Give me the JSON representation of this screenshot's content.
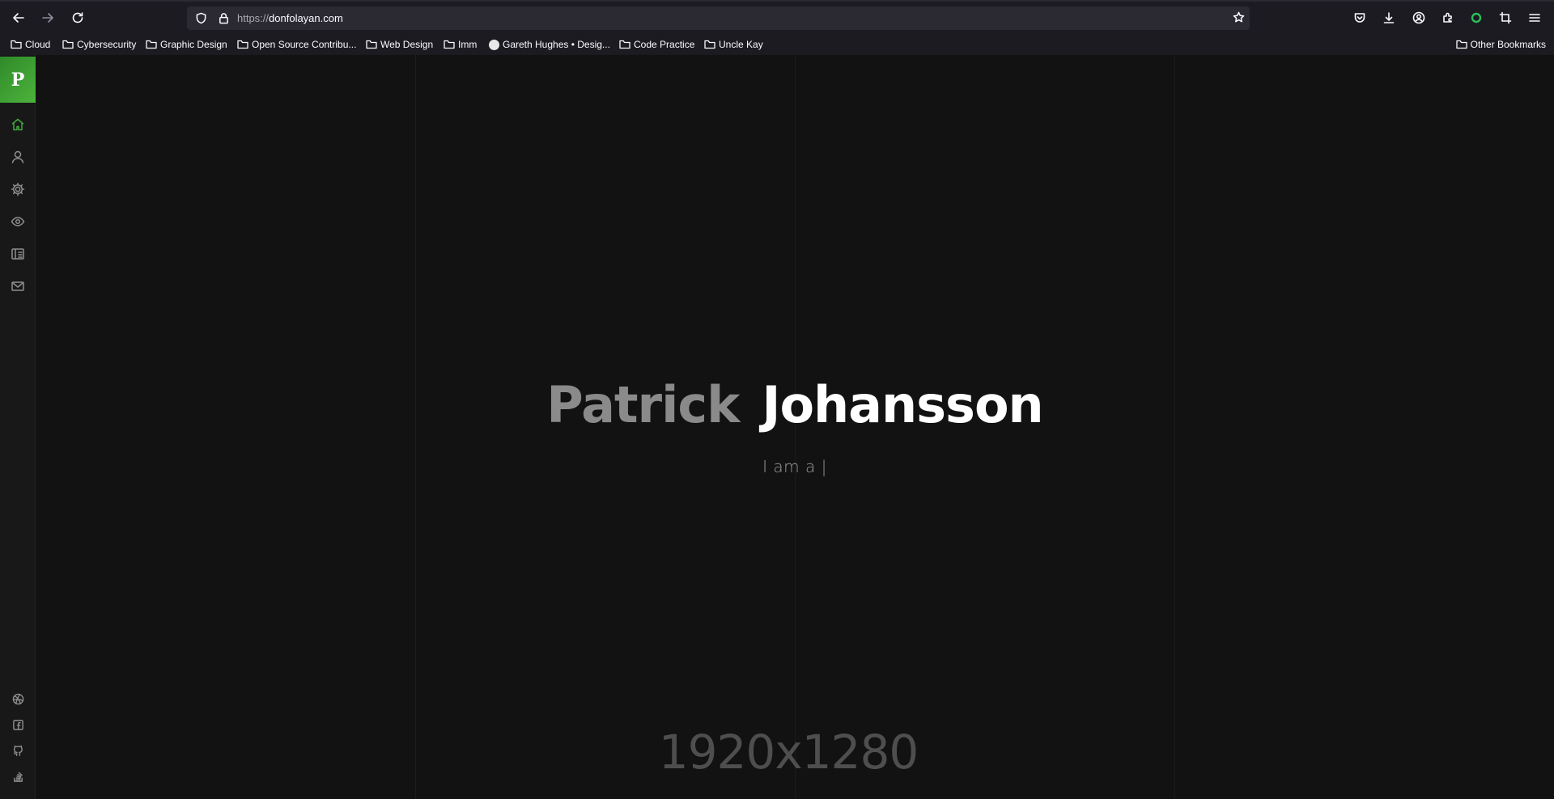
{
  "browser": {
    "url_protocol": "https://",
    "url_host": "donfolayan.com",
    "toolbar_icons": [
      "pocket-icon",
      "download-icon",
      "account-icon",
      "extensions-icon",
      "extension-green-icon",
      "crop-icon",
      "menu-icon"
    ]
  },
  "bookmarks": {
    "items": [
      {
        "label": "Cloud",
        "icon": "folder-icon"
      },
      {
        "label": "Cybersecurity",
        "icon": "folder-icon"
      },
      {
        "label": "Graphic Design",
        "icon": "folder-icon"
      },
      {
        "label": "Open Source Contribu...",
        "icon": "folder-icon"
      },
      {
        "label": "Web Design",
        "icon": "folder-icon"
      },
      {
        "label": "Imm",
        "icon": "folder-icon"
      },
      {
        "label": "Gareth Hughes • Desig...",
        "icon": "site-favicon"
      },
      {
        "label": "Code Practice",
        "icon": "folder-icon"
      },
      {
        "label": "Uncle Kay",
        "icon": "folder-icon"
      }
    ],
    "other": "Other Bookmarks"
  },
  "sidebar": {
    "logo": "P",
    "accent_color": "#3fa93a",
    "nav": [
      "home-icon",
      "user-icon",
      "settings-icon",
      "eye-icon",
      "portfolio-icon",
      "mail-icon"
    ],
    "social": [
      "dribbble-icon",
      "facebook-icon",
      "github-icon",
      "stackoverflow-icon"
    ]
  },
  "hero": {
    "first_name": "Patrick",
    "last_name": "Johansson",
    "subtitle": "I am a |",
    "placeholder_label": "1920x1280"
  }
}
